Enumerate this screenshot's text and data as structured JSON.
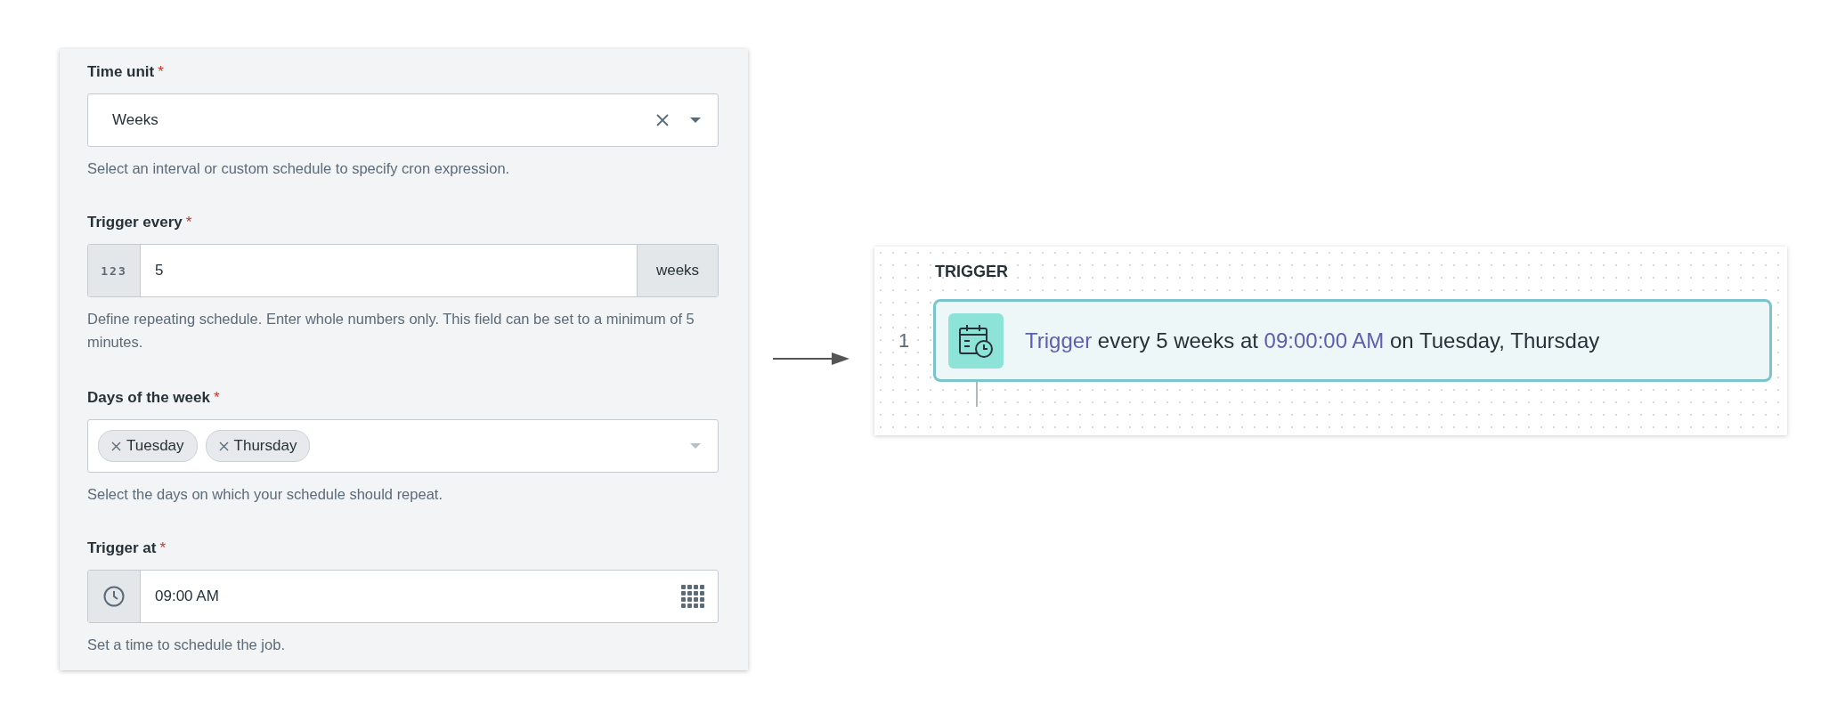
{
  "form": {
    "fields": [
      {
        "kind": "select",
        "label": "Time unit",
        "required_mark": "*",
        "value": "Weeks",
        "help": "Select an interval or custom schedule to specify cron expression."
      },
      {
        "kind": "number",
        "label": "Trigger every",
        "required_mark": "*",
        "prefix": "123",
        "value": "5",
        "suffix": "weeks",
        "help": "Define repeating schedule. Enter whole numbers only. This field can be set to a minimum of 5 minutes."
      },
      {
        "kind": "multiselect",
        "label": "Days of the week",
        "required_mark": "*",
        "tags": [
          "Tuesday",
          "Thursday"
        ],
        "help": "Select the days on which your schedule should repeat."
      },
      {
        "kind": "time",
        "label": "Trigger at",
        "required_mark": "*",
        "value": "09:00 AM",
        "help": "Set a time to schedule the job."
      }
    ]
  },
  "canvas": {
    "section": "TRIGGER",
    "steps": [
      {
        "number": "1",
        "parts": [
          {
            "kind": "keyword",
            "text": "Trigger"
          },
          {
            "kind": "text",
            "text": "every 5 weeks at"
          },
          {
            "kind": "keyword",
            "text": "09:00:00 AM"
          },
          {
            "kind": "text",
            "text": "on Tuesday, Thursday"
          }
        ]
      }
    ]
  }
}
